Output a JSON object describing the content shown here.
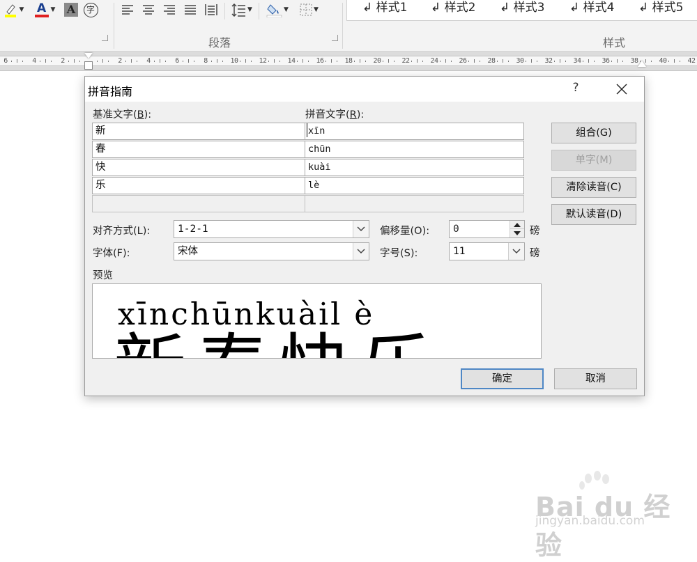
{
  "ribbon": {
    "paragraph_group_label": "段落",
    "styles_group_label": "样式",
    "style_items": [
      "↲ 样式1",
      "↲ 样式2",
      "↲ 样式3",
      "↲ 样式4",
      "↲ 样式5"
    ],
    "char_shading_label": "A",
    "font_color_label": "A",
    "enclose_char_label": "字",
    "highlight_color": "#ffff00",
    "font_color": "#e02020"
  },
  "ruler": {
    "numbers": [
      "6",
      "4",
      "2",
      "",
      "2",
      "4",
      "6",
      "8",
      "10",
      "12",
      "14",
      "16",
      "18",
      "20",
      "22",
      "24",
      "26",
      "28",
      "30",
      "32",
      "34",
      "36",
      "38",
      "40",
      "42"
    ]
  },
  "dialog": {
    "title": "拼音指南",
    "help_label": "?",
    "base_text_label": "基准文字(",
    "base_text_key": "B",
    "base_text_tail": "):",
    "pinyin_text_label": "拼音文字(",
    "pinyin_text_key": "R",
    "pinyin_text_tail": "):",
    "rows": [
      {
        "base": "新",
        "pinyin": "xīn"
      },
      {
        "base": "春",
        "pinyin": "chūn"
      },
      {
        "base": "快",
        "pinyin": "kuài"
      },
      {
        "base": "乐",
        "pinyin": "lè"
      },
      {
        "base": "",
        "pinyin": ""
      }
    ],
    "buttons": {
      "group": "组合(G)",
      "mono": "单字(M)",
      "clear": "清除读音(C)",
      "default_reading": "默认读音(D)",
      "ok": "确定",
      "cancel": "取消"
    },
    "alignment_label": "对齐方式(L):",
    "alignment_value": "1-2-1",
    "font_label": "字体(F):",
    "font_value": "宋体",
    "offset_label": "偏移量(O):",
    "offset_value": "0",
    "size_label": "字号(S):",
    "size_value": "11",
    "unit": "磅",
    "preview_label": "预览",
    "preview_pinyin": "xīnchūnkuàil è",
    "preview_base": "新春快乐"
  },
  "watermark": {
    "brand": "Bai du 经验",
    "url": "jingyan.baidu.com"
  }
}
